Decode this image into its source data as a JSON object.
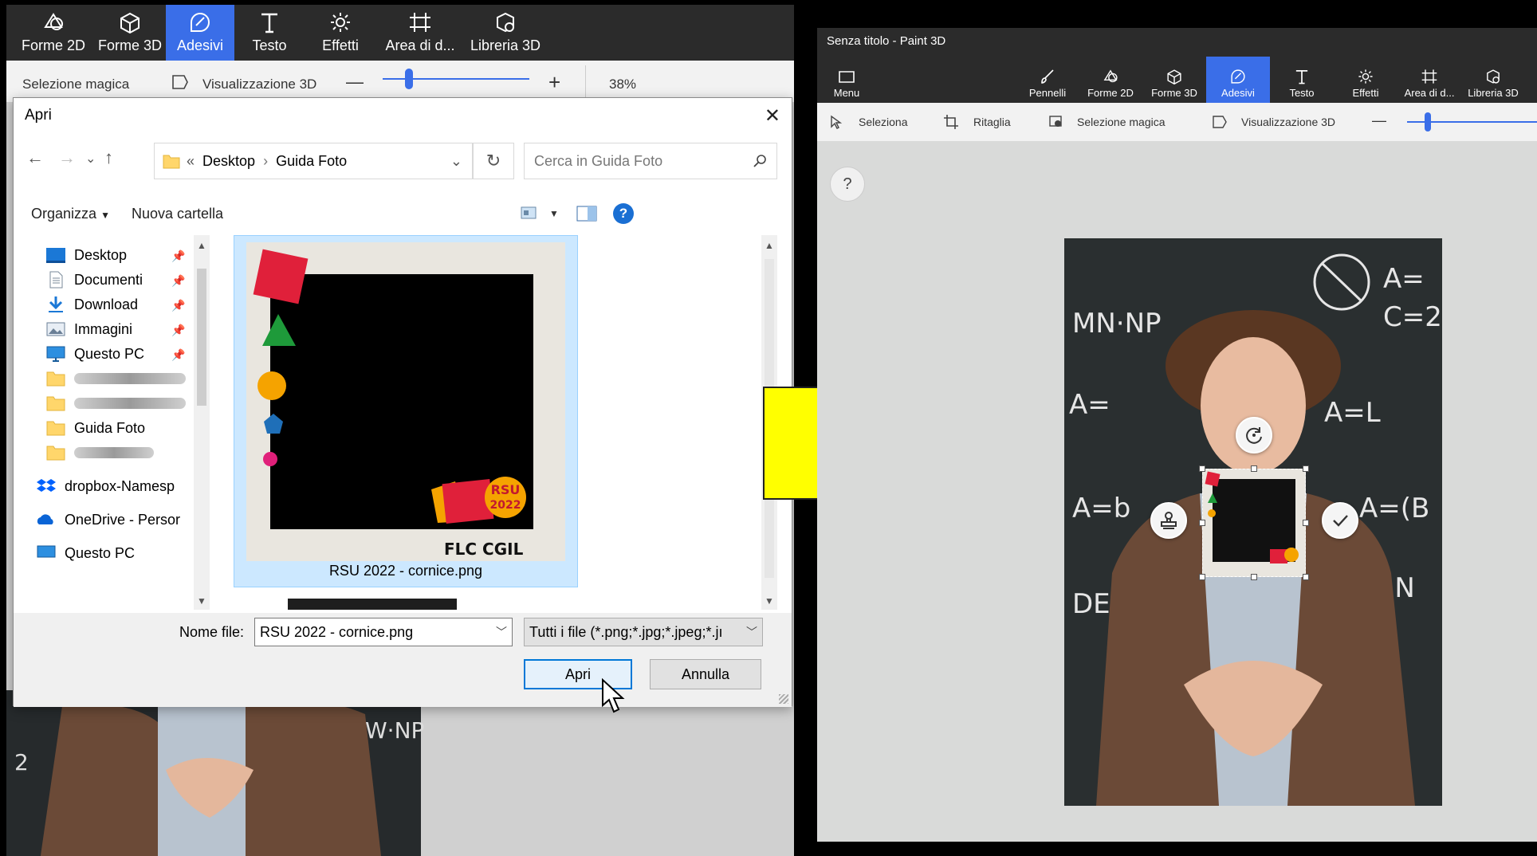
{
  "left_app": {
    "tabs": [
      {
        "label": "Forme 2D",
        "icon": "shapes-2d-icon"
      },
      {
        "label": "Forme 3D",
        "icon": "cube-icon"
      },
      {
        "label": "Adesivi",
        "icon": "sticker-icon",
        "active": true
      },
      {
        "label": "Testo",
        "icon": "text-icon"
      },
      {
        "label": "Effetti",
        "icon": "effects-icon"
      },
      {
        "label": "Area di d...",
        "icon": "canvas-icon"
      },
      {
        "label": "Libreria 3D",
        "icon": "library-3d-icon"
      }
    ],
    "toolbar": {
      "magic_select": "Selezione magica",
      "view3d": "Visualizzazione 3D",
      "zoom_minus": "—",
      "zoom_plus": "+",
      "zoom": "38%"
    }
  },
  "dialog": {
    "title": "Apri",
    "close": "✕",
    "nav": {
      "back": "←",
      "forward": "→",
      "recent": "⌄",
      "up": "↑",
      "refresh": "↻"
    },
    "path": {
      "prefix": "«",
      "segments": [
        "Desktop",
        "Guida Foto"
      ],
      "separator": "›",
      "dropdown": "⌄"
    },
    "search_placeholder": "Cerca in Guida Foto",
    "commands": {
      "organize": "Organizza",
      "new_folder": "Nuova cartella",
      "help": "?"
    },
    "nav_items": [
      {
        "label": "Desktop",
        "icon": "desktop-folder-icon",
        "pinned": true
      },
      {
        "label": "Documenti",
        "icon": "documents-icon",
        "pinned": true
      },
      {
        "label": "Download",
        "icon": "download-icon",
        "pinned": true
      },
      {
        "label": "Immagini",
        "icon": "pictures-icon",
        "pinned": true
      },
      {
        "label": "Questo PC",
        "icon": "this-pc-icon",
        "pinned": true
      },
      {
        "label": "",
        "icon": "folder-icon",
        "blurred": true
      },
      {
        "label": "",
        "icon": "folder-icon",
        "blurred": true
      },
      {
        "label": "Guida Foto",
        "icon": "folder-icon"
      },
      {
        "label": "",
        "icon": "folder-icon",
        "blurred": true
      },
      {
        "label": "dropbox-Namesp",
        "icon": "dropbox-icon"
      },
      {
        "label": "OneDrive - Persor",
        "icon": "onedrive-icon"
      },
      {
        "label": "Questo PC",
        "icon": "this-pc-icon"
      }
    ],
    "file": {
      "name": "RSU 2022 - cornice.png",
      "logo_text": "FLC CGIL",
      "badge_line1": "RSU",
      "badge_line2": "2022"
    },
    "bottom": {
      "filename_label": "Nome file:",
      "filename_value": "RSU 2022 - cornice.png",
      "filter_value": "Tutti i file (*.png;*.jpg;*.jpeg;*.jı",
      "open_button": "Apri",
      "cancel_button": "Annulla"
    }
  },
  "right_app": {
    "window_title": "Senza titolo - Paint 3D",
    "tabs": [
      {
        "label": "Menu",
        "icon": "menu-folder-icon"
      },
      {
        "label": "Pennelli",
        "icon": "brush-icon"
      },
      {
        "label": "Forme 2D",
        "icon": "shapes-2d-icon"
      },
      {
        "label": "Forme 3D",
        "icon": "cube-icon"
      },
      {
        "label": "Adesivi",
        "icon": "sticker-icon",
        "active": true
      },
      {
        "label": "Testo",
        "icon": "text-icon"
      },
      {
        "label": "Effetti",
        "icon": "effects-icon"
      },
      {
        "label": "Area di d...",
        "icon": "canvas-icon"
      },
      {
        "label": "Libreria 3D",
        "icon": "library-3d-icon"
      }
    ],
    "toolbar": {
      "select": "Seleziona",
      "crop": "Ritaglia",
      "magic_select": "Selezione magica",
      "view3d": "Visualizzazione 3D",
      "zoom_minus": "—"
    },
    "help": "?"
  },
  "colors": {
    "accent": "#3a6ee8",
    "ribbon_bg": "#2b2b2b",
    "selection_bg": "#cce8ff",
    "arrow": "#ffff00",
    "sticker_red": "#e0203a",
    "sticker_green": "#1e9a3a",
    "sticker_orange": "#f5a300",
    "sticker_blue": "#1f6fb8",
    "sticker_pink": "#e0207a"
  }
}
